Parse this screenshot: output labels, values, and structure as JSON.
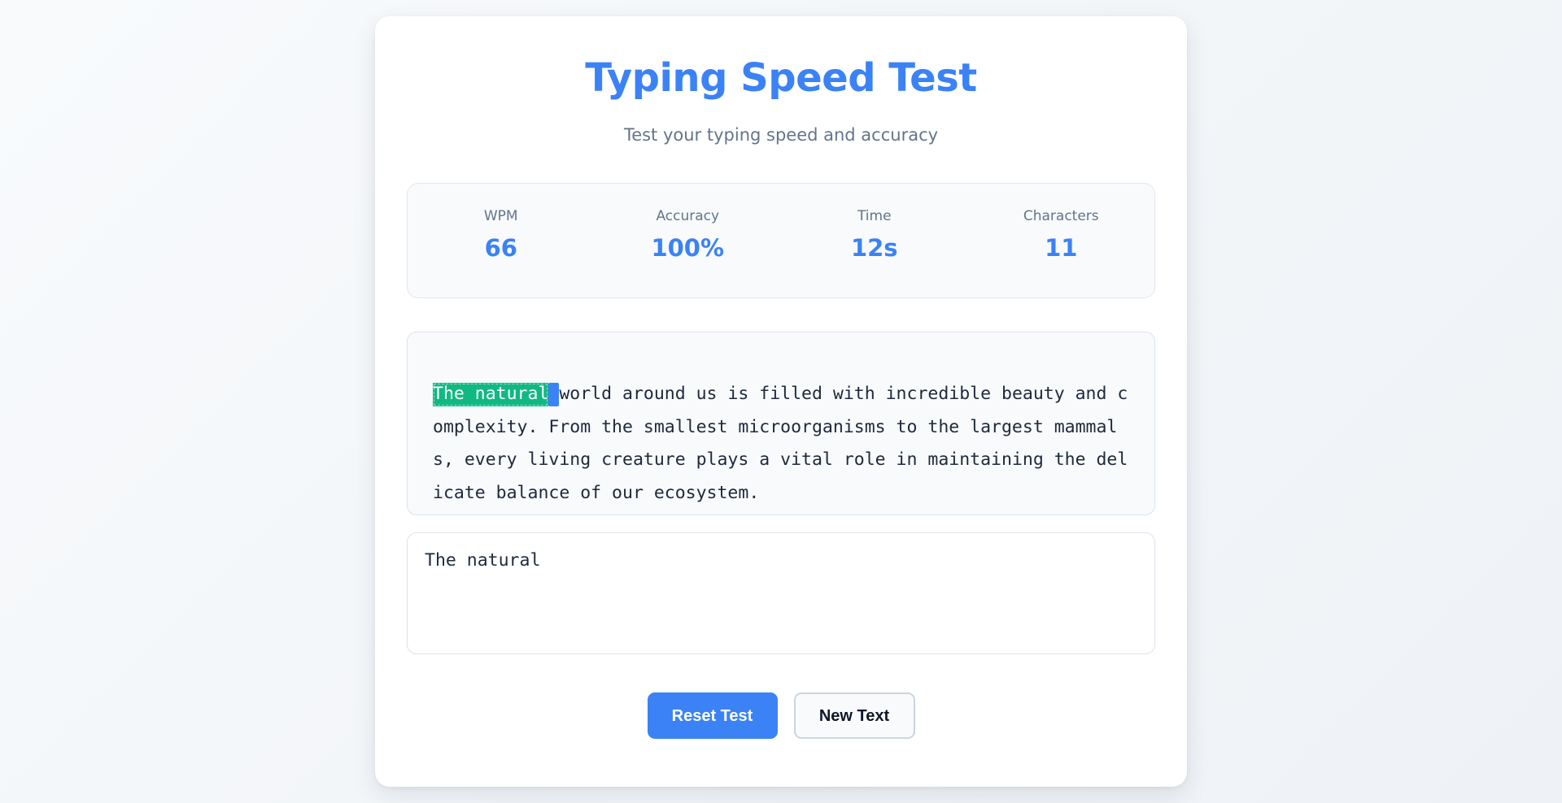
{
  "header": {
    "title": "Typing Speed Test",
    "subtitle": "Test your typing speed and accuracy"
  },
  "stats": [
    {
      "label": "WPM",
      "value": "66"
    },
    {
      "label": "Accuracy",
      "value": "100%"
    },
    {
      "label": "Time",
      "value": "12s"
    },
    {
      "label": "Characters",
      "value": "11"
    }
  ],
  "passage": {
    "typed": "The natural",
    "current": " ",
    "remaining": "world around us is filled with incredible beauty and complexity. From the smallest microorganisms to the largest mammals, every living creature plays a vital role in maintaining the delicate balance of our ecosystem."
  },
  "input": {
    "value": "The natural"
  },
  "buttons": {
    "reset": "Reset Test",
    "new_text": "New Text"
  },
  "colors": {
    "accent": "#3b82f6",
    "typed_correct": "#10b981",
    "muted_text": "#64748b"
  }
}
